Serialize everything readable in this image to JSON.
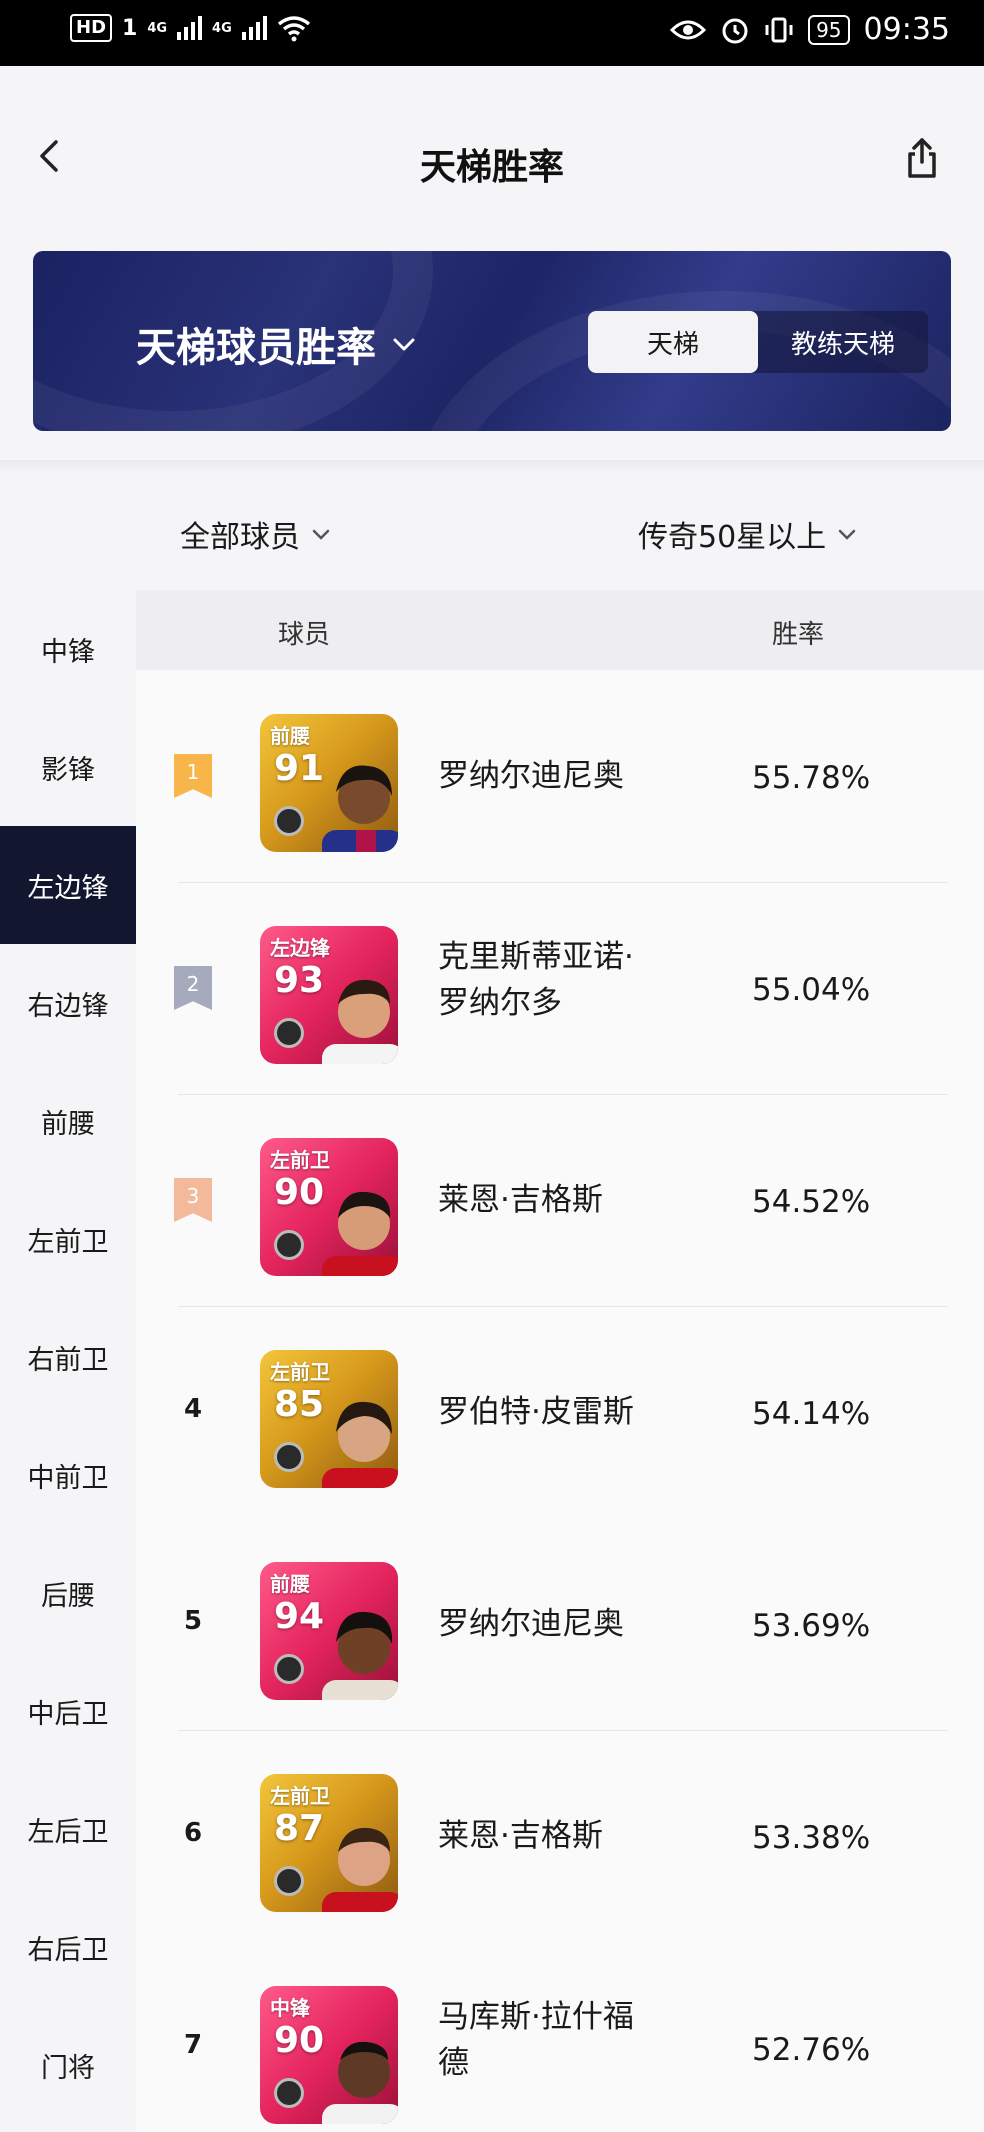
{
  "status_bar": {
    "hd_label": "HD",
    "sim_label": "1",
    "net1": "4G",
    "net2": "4G",
    "battery": "95",
    "time": "09:35"
  },
  "header": {
    "title": "天梯胜率"
  },
  "banner": {
    "title": "天梯球员胜率",
    "tabs": [
      {
        "label": "天梯",
        "active": true
      },
      {
        "label": "教练天梯",
        "active": false
      }
    ]
  },
  "filters": {
    "player_filter": "全部球员",
    "level_filter": "传奇50星以上"
  },
  "sidebar": {
    "items": [
      {
        "label": "中锋",
        "active": false
      },
      {
        "label": "影锋",
        "active": false
      },
      {
        "label": "左边锋",
        "active": true
      },
      {
        "label": "右边锋",
        "active": false
      },
      {
        "label": "前腰",
        "active": false
      },
      {
        "label": "左前卫",
        "active": false
      },
      {
        "label": "右前卫",
        "active": false
      },
      {
        "label": "中前卫",
        "active": false
      },
      {
        "label": "后腰",
        "active": false
      },
      {
        "label": "中后卫",
        "active": false
      },
      {
        "label": "左后卫",
        "active": false
      },
      {
        "label": "右后卫",
        "active": false
      },
      {
        "label": "门将",
        "active": false
      }
    ]
  },
  "table": {
    "col_player": "球员",
    "col_rate": "胜率",
    "rows": [
      {
        "rank": "1",
        "position": "前腰",
        "rating": "91",
        "card_color": "gold",
        "name_lines": [
          "罗纳尔迪尼奥"
        ],
        "win_rate": "55.78%"
      },
      {
        "rank": "2",
        "position": "左边锋",
        "rating": "93",
        "card_color": "pink",
        "name_lines": [
          "克里斯蒂亚诺·",
          "罗纳尔多"
        ],
        "win_rate": "55.04%"
      },
      {
        "rank": "3",
        "position": "左前卫",
        "rating": "90",
        "card_color": "pink",
        "name_lines": [
          "莱恩·吉格斯"
        ],
        "win_rate": "54.52%"
      },
      {
        "rank": "4",
        "position": "左前卫",
        "rating": "85",
        "card_color": "gold",
        "name_lines": [
          "罗伯特·皮雷斯"
        ],
        "win_rate": "54.14%"
      },
      {
        "rank": "5",
        "position": "前腰",
        "rating": "94",
        "card_color": "pink",
        "name_lines": [
          "罗纳尔迪尼奥"
        ],
        "win_rate": "53.69%"
      },
      {
        "rank": "6",
        "position": "左前卫",
        "rating": "87",
        "card_color": "gold",
        "name_lines": [
          "莱恩·吉格斯"
        ],
        "win_rate": "53.38%"
      },
      {
        "rank": "7",
        "position": "中锋",
        "rating": "90",
        "card_color": "pink",
        "name_lines": [
          "马库斯·拉什福",
          "德"
        ],
        "win_rate": "52.76%"
      }
    ]
  },
  "colors": {
    "rank1": "#f7b54a",
    "rank2": "#a5abbd",
    "rank3": "#f2b99a",
    "active_sidebar": "#12162e"
  }
}
